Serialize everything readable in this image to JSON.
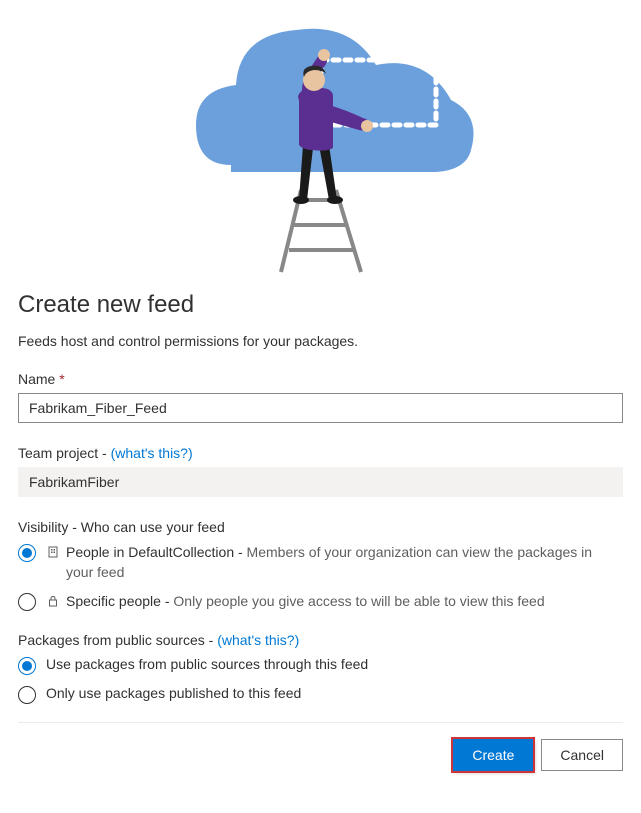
{
  "heading": "Create new feed",
  "subtitle": "Feeds host and control permissions for your packages.",
  "nameLabel": "Name",
  "nameRequired": "*",
  "nameValue": "Fabrikam_Fiber_Feed",
  "teamProjectLabel": "Team project - ",
  "whatsThis": "(what's this?)",
  "teamProjectValue": "FabrikamFiber",
  "visibilityLabel": "Visibility - Who can use your feed",
  "visibility": {
    "org": {
      "prefix": "People in DefaultCollection - ",
      "desc": "Members of your organization can view the packages in your feed"
    },
    "specific": {
      "prefix": "Specific people - ",
      "desc": "Only people you give access to will be able to view this feed"
    }
  },
  "publicSourcesLabel": "Packages from public sources - ",
  "publicSources": {
    "use": "Use packages from public sources through this feed",
    "only": "Only use packages published to this feed"
  },
  "buttons": {
    "create": "Create",
    "cancel": "Cancel"
  }
}
